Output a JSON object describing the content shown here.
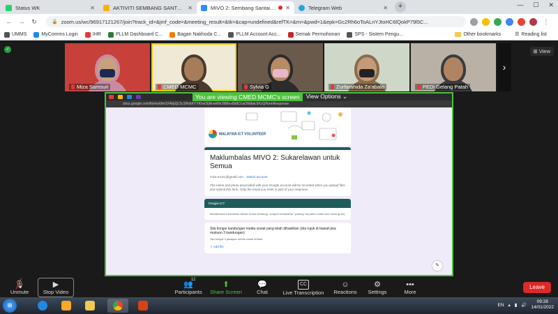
{
  "browser": {
    "tabs": [
      {
        "title": "Status WK",
        "color": "#25d366",
        "active": false
      },
      {
        "title": "AKTIVITI SEMBANG SANTAI BER",
        "color": "#f4b400",
        "active": false
      },
      {
        "title": "MIVO 2: Sembang Santai Ku",
        "color": "#2d8cff",
        "active": true
      },
      {
        "title": "Telegram Web",
        "color": "#2aa3dd",
        "active": false
      }
    ],
    "new_tab": "+",
    "url": "zoom.us/wc/96917121267/join?track_id=&jmf_code=&meeting_result=&tk=&cap=undefined&refTK=&rn=&pwd=1&epk=Gc2Rh6oToALnYJtoHC6lQokP79l5C...",
    "bookmarks": [
      {
        "label": "UMMS",
        "color": "#555"
      },
      {
        "label": "MyComms Login",
        "color": "#1e88e5"
      },
      {
        "label": "IHR",
        "color": "#e53935"
      },
      {
        "label": "PLLM Dashboard C...",
        "color": "#2e7d32"
      },
      {
        "label": "Bagan Nakhoda C...",
        "color": "#f57c00"
      },
      {
        "label": "PLLM Account Acc...",
        "color": "#555"
      },
      {
        "label": "Semak Permohonan",
        "color": "#c62828"
      },
      {
        "label": "SPS - Sistem Pengu...",
        "color": "#555"
      }
    ],
    "other_bookmarks": "Other bookmarks",
    "reading_list": "Reading list"
  },
  "zoom": {
    "participants": [
      {
        "name": "Miza Samsuri",
        "bg": "#c7403a",
        "skin": "#c9a07e",
        "hijab": "#c98ba3",
        "mask": "#1b2a55",
        "speaking": false
      },
      {
        "name": "CMED MCMC",
        "bg": "#efe9d6",
        "skin": "#a67c5b",
        "hijab": "#4a3a2e",
        "mask": "",
        "speaking": true
      },
      {
        "name": "Sylvia G",
        "bg": "#6a5a4c",
        "skin": "#b88a66",
        "hijab": "#2b2b2b",
        "mask": "#e9b8c8",
        "speaking": false
      },
      {
        "name": "Zurfarahida Za'abalo",
        "bg": "#cfd8c8",
        "skin": "#c49a78",
        "hijab": "#8a6d4b",
        "mask": "#222222",
        "speaking": false
      },
      {
        "name": "PEDi Gelang Patah",
        "bg": "#b9b1a6",
        "skin": "#b08462",
        "hijab": "#3b3b3b",
        "mask": "",
        "speaking": false
      }
    ],
    "view_label": "View",
    "viewing_banner": "You are viewing CMED MCMC's screen",
    "view_options": "View Options",
    "shared": {
      "url": "docs.google.com/forms/d/e/1FAIpQLSc1RvbXYYKhsOIjNrwW9r3M8nx6b8D1aO8dbdc9XzQ/formResponse",
      "logo_text": "MALAYSIA ICT VOLUNTEER",
      "form_title": "Maklumbalas MIVO 2: Sukarelawan untuk Semua",
      "email": "miza.mcmc@gmail.com",
      "switch_account": "Switch account",
      "meta": "The name and photo associated with your Google account will be recorded when you upload files and submit this form. Only the email you enter is part of your response.",
      "section_title": "Pengisi ICT",
      "section_body": "Memberikan Kemahiran Media Sosial (Strategi - tetapi/3 kemahiran \"posting\" kepada Lindsa dan Lasat gu lis)",
      "question": "Sila kongsi kandungan media sosial yang telah dihasilkan (sila rujuk di bawah jika mukuon 3 kandungan)",
      "question_sub": "Sila kongsi 3 jawapan media sosial terbaik.",
      "add_file": "Add file"
    },
    "toolbar": {
      "unmute": "Unmute",
      "stop_video": "Stop Video",
      "participants": "Participants",
      "participants_count": "12",
      "share_screen": "Share Screen",
      "chat": "Chat",
      "live_transcription": "Live Transcription",
      "cc": "CC",
      "reactions": "Reactions",
      "settings": "Settings",
      "more": "More",
      "leave": "Leave"
    }
  },
  "taskbar": {
    "lang": "EN",
    "time": "09:28",
    "date": "14/01/2022"
  }
}
